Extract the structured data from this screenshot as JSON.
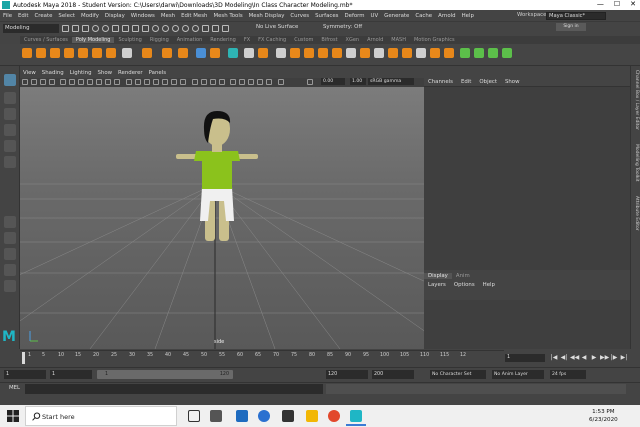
{
  "window": {
    "title": "Autodesk Maya 2018 - Student Version: C:\\Users\\darwi\\Downloads\\3D Modeling\\In Class Character Modeling.mb*",
    "controls": [
      "—",
      "☐",
      "✕"
    ]
  },
  "menubar": {
    "items": [
      "File",
      "Edit",
      "Create",
      "Select",
      "Modify",
      "Display",
      "Windows",
      "Mesh",
      "Edit Mesh",
      "Mesh Tools",
      "Mesh Display",
      "Curves",
      "Surfaces",
      "Deform",
      "UV",
      "Generate",
      "Cache",
      "Arnold",
      "Help"
    ],
    "workspace_label": "Workspace :",
    "workspace_value": "Maya Classic*"
  },
  "statusline": {
    "mode": "Modeling",
    "live_surface": "No Live Surface",
    "symmetry": "Symmetry: Off",
    "sign_in": "Sign in"
  },
  "shelf": {
    "tabs": [
      "Curves / Surfaces",
      "Poly Modeling",
      "Sculpting",
      "Rigging",
      "Animation",
      "Rendering",
      "FX",
      "FX Caching",
      "Custom",
      "Bifrost",
      "XGen",
      "Arnold",
      "MASH",
      "Motion Graphics"
    ],
    "active_tab": "Poly Modeling"
  },
  "viewport": {
    "menu": [
      "View",
      "Shading",
      "Lighting",
      "Show",
      "Renderer",
      "Panels"
    ],
    "exposure": "0.00",
    "gamma": "1.00",
    "color_space": "sRGB gamma",
    "camera_label": "side"
  },
  "channelbox": {
    "menu": [
      "Channels",
      "Edit",
      "Object",
      "Show"
    ],
    "side_tabs": [
      "Channel Box / Layer Editor",
      "Modelling Toolkit",
      "Attribute Editor"
    ]
  },
  "layers": {
    "tabs": [
      "Display",
      "Anim"
    ],
    "active_tab": "Display",
    "menu": [
      "Layers",
      "Options",
      "Help"
    ]
  },
  "timeslider": {
    "ticks": [
      "1",
      "5",
      "10",
      "15",
      "20",
      "25",
      "30",
      "35",
      "40",
      "45",
      "50",
      "55",
      "60",
      "65",
      "70",
      "75",
      "80",
      "85",
      "90",
      "95",
      "100",
      "105",
      "110",
      "115",
      "12"
    ],
    "current_frame": "1",
    "playback": [
      "|◀",
      "◀|",
      "◀◀",
      "◀",
      "▶",
      "▶▶",
      "|▶",
      "▶|"
    ]
  },
  "rangeslider": {
    "start": "1",
    "playback_start": "1",
    "range_left": "1",
    "range_right": "120",
    "playback_end": "120",
    "end": "200",
    "character_set": "No Character Set",
    "anim_layer": "No Anim Layer",
    "fps": "24 fps"
  },
  "cmdline": {
    "label": "MEL"
  },
  "taskbar": {
    "search_placeholder": "Start here",
    "time": "1:53 PM",
    "date": "6/23/2020"
  },
  "colors": {
    "maya_accent": "#1fb6c5",
    "shirt": "#8bc21c",
    "skin": "#c9bf8c",
    "pants": "#f0f0f0",
    "hair": "#111111"
  }
}
